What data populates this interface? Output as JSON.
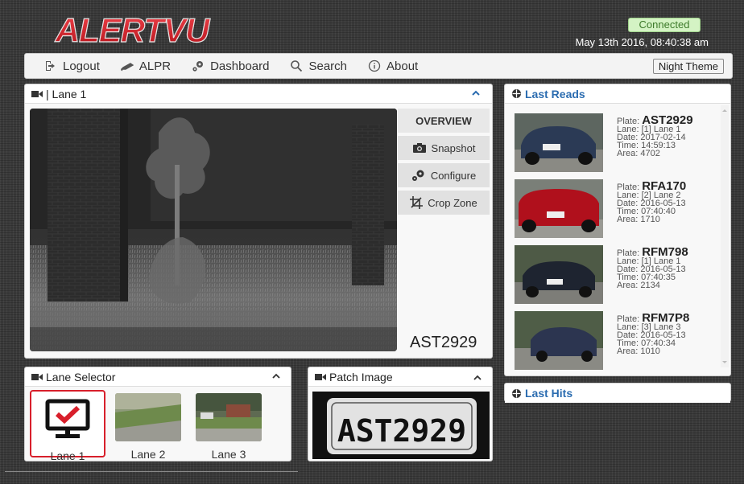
{
  "app": {
    "logo_text": "ALERTVU",
    "status": "Connected",
    "datetime": "May 13th 2016, 08:40:38 am"
  },
  "nav": {
    "items": [
      {
        "label": "Logout",
        "icon": "logout-icon"
      },
      {
        "label": "ALPR",
        "icon": "camera-alpr-icon"
      },
      {
        "label": "Dashboard",
        "icon": "cogs-icon"
      },
      {
        "label": "Search",
        "icon": "search-icon"
      },
      {
        "label": "About",
        "icon": "info-icon"
      }
    ],
    "theme_button": "Night Theme"
  },
  "lane_panel": {
    "title": "| Lane 1",
    "buttons": {
      "overview": "OVERVIEW",
      "snapshot": "Snapshot",
      "configure": "Configure",
      "crop_zone": "Crop Zone"
    },
    "plate": "AST2929"
  },
  "last_reads": {
    "title": "Last Reads",
    "items": [
      {
        "plate_label": "Plate: ",
        "plate": "AST2929",
        "lane": "Lane: [1] Lane 1",
        "date": "Date: 2017-02-14",
        "time": "Time: 14:59:13",
        "area": "Area: 4702"
      },
      {
        "plate_label": "Plate: ",
        "plate": "RFA170",
        "lane": "Lane: [2] Lane 2",
        "date": "Date: 2016-05-13",
        "time": "Time: 07:40:40",
        "area": "Area: 1710"
      },
      {
        "plate_label": "Plate: ",
        "plate": "RFM798",
        "lane": "Lane: [1] Lane 1",
        "date": "Date: 2016-05-13",
        "time": "Time: 07:40:35",
        "area": "Area: 2134"
      },
      {
        "plate_label": "Plate: ",
        "plate": "RFM7P8",
        "lane": "Lane: [3] Lane 3",
        "date": "Date: 2016-05-13",
        "time": "Time: 07:40:34",
        "area": "Area: 1010"
      }
    ]
  },
  "last_hits": {
    "title": "Last Hits"
  },
  "lane_selector": {
    "title": "Lane Selector",
    "lanes": [
      {
        "label": "Lane 1"
      },
      {
        "label": "Lane 2"
      },
      {
        "label": "Lane 3"
      }
    ]
  },
  "patch_image": {
    "title": "Patch Image",
    "plate": "AST2929"
  },
  "colors": {
    "logo_red": "#d2232a",
    "accent_blue": "#2b6cb0",
    "selected_red": "#d81f2b",
    "status_green": "#d4f3c4"
  }
}
